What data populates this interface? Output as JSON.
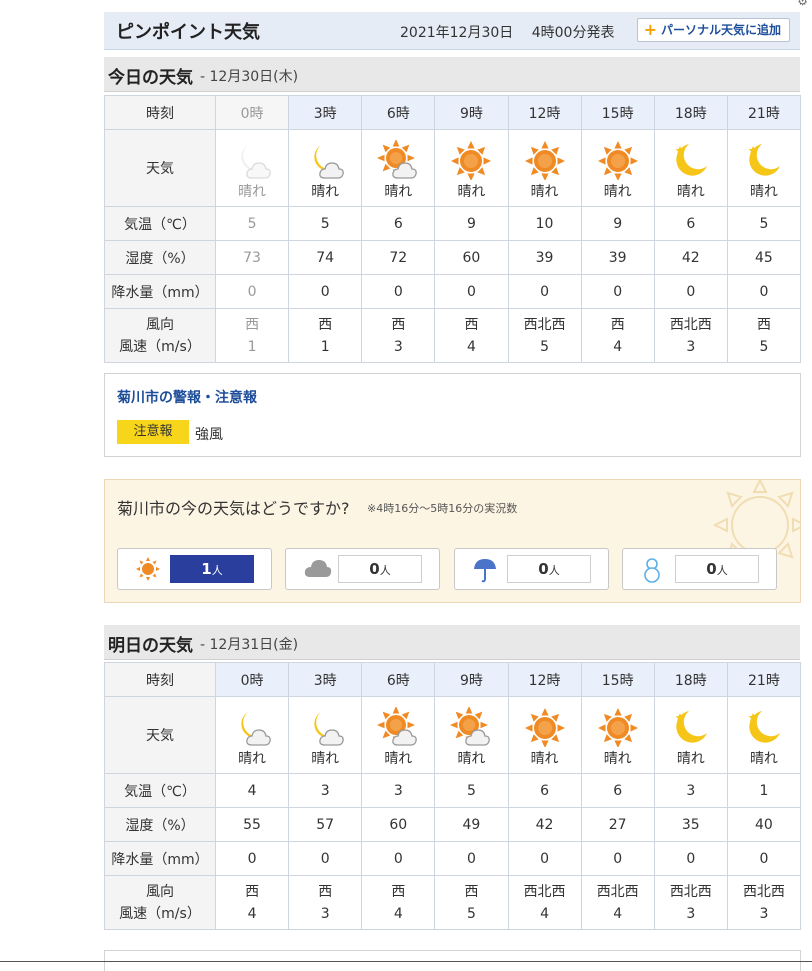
{
  "corner_text": "⚙",
  "header": {
    "title": "ピンポイント天気",
    "issued_date": "2021年12月30日",
    "issued_time": "4時00分発表",
    "add_button_label": "パーソナル天気に追加"
  },
  "today": {
    "title": "今日の天気",
    "date": "- 12月30日(木)",
    "labels": {
      "time": "時刻",
      "weather": "天気",
      "temp": "気温（℃）",
      "humidity": "湿度（%）",
      "precip": "降水量（mm）",
      "wind_dir": "風向",
      "wind_speed": "風速（m/s）"
    },
    "times": [
      "0時",
      "3時",
      "6時",
      "9時",
      "12時",
      "15時",
      "18時",
      "21時"
    ],
    "icons": [
      "moon-cloud-icon",
      "moon-cloud-icon",
      "sun-cloud-icon",
      "sun-icon",
      "sun-icon",
      "sun-icon",
      "crescent-star-icon",
      "crescent-star-icon"
    ],
    "weather": [
      "晴れ",
      "晴れ",
      "晴れ",
      "晴れ",
      "晴れ",
      "晴れ",
      "晴れ",
      "晴れ"
    ],
    "temp": [
      "5",
      "5",
      "6",
      "9",
      "10",
      "9",
      "6",
      "5"
    ],
    "humidity": [
      "73",
      "74",
      "72",
      "60",
      "39",
      "39",
      "42",
      "45"
    ],
    "precip": [
      "0",
      "0",
      "0",
      "0",
      "0",
      "0",
      "0",
      "0"
    ],
    "wind_dir": [
      "西",
      "西",
      "西",
      "西",
      "西北西",
      "西",
      "西北西",
      "西"
    ],
    "wind_speed": [
      "1",
      "1",
      "3",
      "4",
      "5",
      "4",
      "3",
      "5"
    ]
  },
  "alert": {
    "title": "菊川市の警報・注意報",
    "badge": "注意報",
    "warning": "強風"
  },
  "survey": {
    "question": "菊川市の今の天気はどうですか?",
    "note": "※4時16分～5時16分の実況数",
    "unit": "人",
    "options": [
      {
        "icon": "sun-icon",
        "count": "1"
      },
      {
        "icon": "cloud-icon",
        "count": "0"
      },
      {
        "icon": "umbrella-icon",
        "count": "0"
      },
      {
        "icon": "snowman-icon",
        "count": "0"
      }
    ]
  },
  "tomorrow": {
    "title": "明日の天気",
    "date": "- 12月31日(金)",
    "labels": {
      "time": "時刻",
      "weather": "天気",
      "temp": "気温（℃）",
      "humidity": "湿度（%）",
      "precip": "降水量（mm）",
      "wind_dir": "風向",
      "wind_speed": "風速（m/s）"
    },
    "times": [
      "0時",
      "3時",
      "6時",
      "9時",
      "12時",
      "15時",
      "18時",
      "21時"
    ],
    "icons": [
      "moon-cloud-icon",
      "moon-cloud-icon",
      "sun-cloud-icon",
      "sun-cloud-icon",
      "sun-icon",
      "sun-icon",
      "crescent-star-icon",
      "crescent-star-icon"
    ],
    "weather": [
      "晴れ",
      "晴れ",
      "晴れ",
      "晴れ",
      "晴れ",
      "晴れ",
      "晴れ",
      "晴れ"
    ],
    "temp": [
      "4",
      "3",
      "3",
      "5",
      "6",
      "6",
      "3",
      "1"
    ],
    "humidity": [
      "55",
      "57",
      "60",
      "49",
      "42",
      "27",
      "35",
      "40"
    ],
    "precip": [
      "0",
      "0",
      "0",
      "0",
      "0",
      "0",
      "0",
      "0"
    ],
    "wind_dir": [
      "西",
      "西",
      "西",
      "西",
      "西北西",
      "西北西",
      "西北西",
      "西北西"
    ],
    "wind_speed": [
      "4",
      "3",
      "4",
      "5",
      "4",
      "4",
      "3",
      "3"
    ]
  },
  "colors": {
    "sun": "#f08a24",
    "moon": "#f5c518",
    "accent": "#1e4d9a",
    "badge": "#f7d51b",
    "vote_active": "#2a3e9e"
  }
}
